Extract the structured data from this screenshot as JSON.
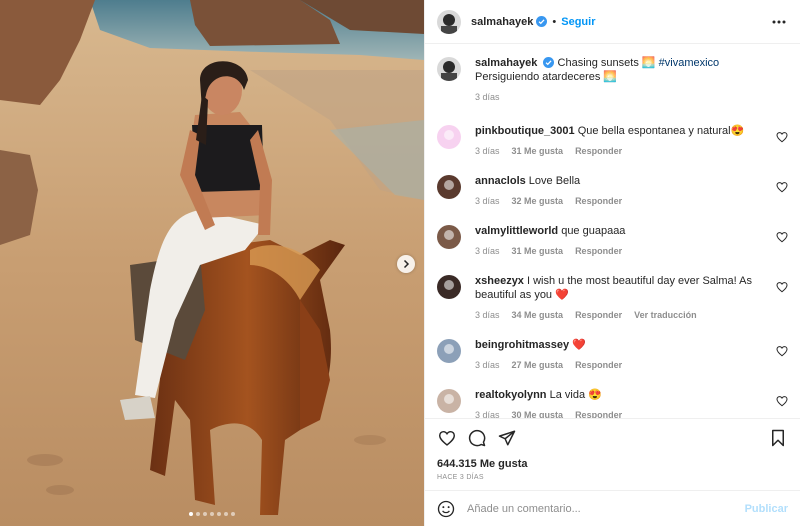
{
  "post": {
    "slides_count": 7,
    "active_slide": 1
  },
  "header": {
    "username": "salmahayek",
    "separator": "•",
    "follow_label": "Seguir"
  },
  "caption": {
    "username": "salmahayek",
    "text": " Chasing sunsets 🌅 ",
    "hashtag": "#vivamexico",
    "text2": "Persiguiendo atardeceres 🌅",
    "time": "3 días"
  },
  "comments": [
    {
      "username": "pinkboutique_3001",
      "text": " Que bella espontanea y natural😍",
      "time": "3 días",
      "likes": "31 Me gusta",
      "reply": "Responder",
      "extra": ""
    },
    {
      "username": "annaclols",
      "text": " Love Bella",
      "time": "3 días",
      "likes": "32 Me gusta",
      "reply": "Responder",
      "extra": ""
    },
    {
      "username": "valmylittleworld",
      "text": " que guapaaa",
      "time": "3 días",
      "likes": "31 Me gusta",
      "reply": "Responder",
      "extra": ""
    },
    {
      "username": "xsheezyx",
      "text": " I wish u the most beautiful day ever Salma! As beautiful as you ❤️",
      "time": "3 días",
      "likes": "34 Me gusta",
      "reply": "Responder",
      "extra": "Ver traducción"
    },
    {
      "username": "beingrohitmassey",
      "text": " ❤️",
      "time": "3 días",
      "likes": "27 Me gusta",
      "reply": "Responder",
      "extra": ""
    },
    {
      "username": "realtokyolynn",
      "text": " La vida 😍",
      "time": "3 días",
      "likes": "30 Me gusta",
      "reply": "Responder",
      "extra": ""
    }
  ],
  "likes_count": "644.315 Me gusta",
  "posted_ago": "HACE 3 DÍAS",
  "composer": {
    "placeholder": "Añade un comentario...",
    "publish_label": "Publicar"
  },
  "colors": {
    "accent": "#0095f6",
    "verified": "#3897f0",
    "muted": "#8e8e8e",
    "like_red": "#ed4956"
  }
}
